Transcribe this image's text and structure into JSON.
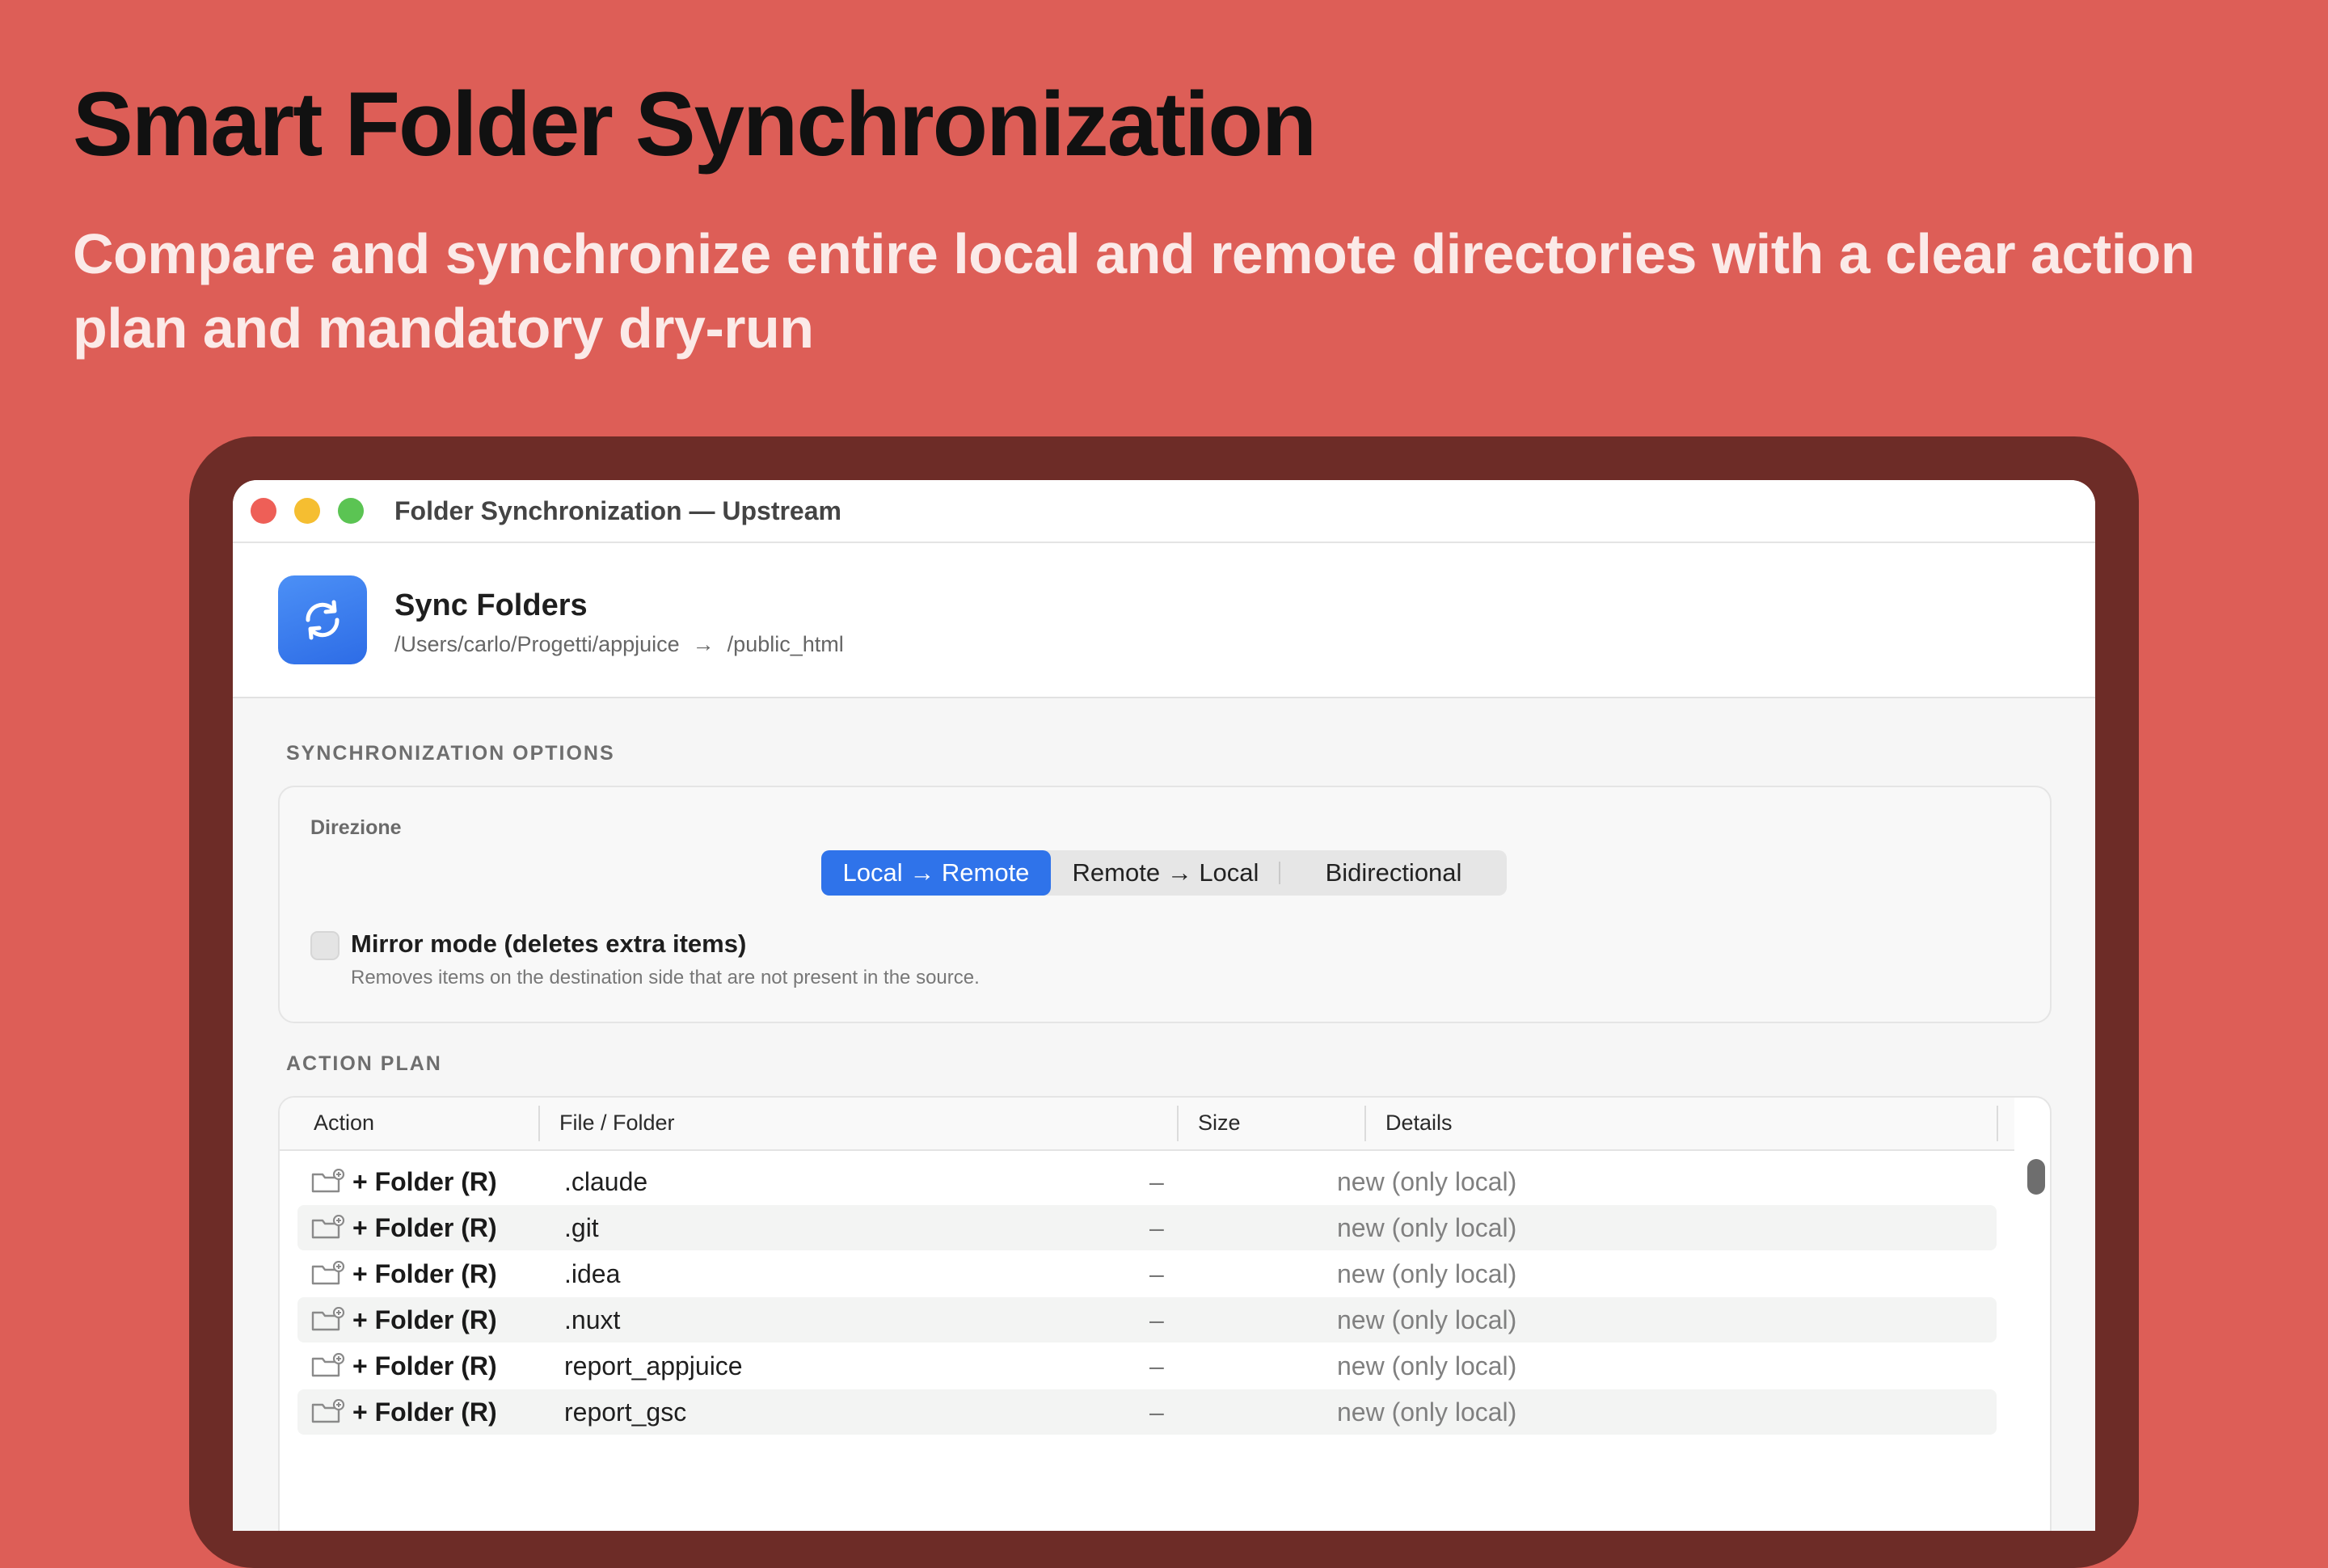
{
  "page": {
    "headline": "Smart Folder Synchronization",
    "subhead": "Compare and synchronize entire local and remote directories with a clear action plan and mandatory dry-run"
  },
  "window": {
    "title": "Folder Synchronization — Upstream"
  },
  "sync_header": {
    "title": "Sync Folders",
    "local_path": "/Users/carlo/Progetti/appjuice",
    "arrow": "→",
    "remote_path": "/public_html",
    "icon": "sync-arrows-icon"
  },
  "options": {
    "section_label": "SYNCHRONIZATION OPTIONS",
    "direction_label": "Direzione",
    "directions": [
      "Local → Remote",
      "Remote → Local",
      "Bidirectional"
    ],
    "selected_direction": "Local → Remote",
    "mirror_label": "Mirror mode (deletes extra items)",
    "mirror_help": "Removes items on the destination side that are not present in the source.",
    "mirror_checked": false
  },
  "action_plan": {
    "section_label": "ACTION PLAN",
    "columns": [
      "Action",
      "File / Folder",
      "Size",
      "Details"
    ],
    "rows": [
      {
        "action": "+ Folder (R)",
        "file": ".claude",
        "size": "–",
        "details": "new (only local)"
      },
      {
        "action": "+ Folder (R)",
        "file": ".git",
        "size": "–",
        "details": "new (only local)"
      },
      {
        "action": "+ Folder (R)",
        "file": ".idea",
        "size": "–",
        "details": "new (only local)"
      },
      {
        "action": "+ Folder (R)",
        "file": ".nuxt",
        "size": "–",
        "details": "new (only local)"
      },
      {
        "action": "+ Folder (R)",
        "file": "report_appjuice",
        "size": "–",
        "details": "new (only local)"
      },
      {
        "action": "+ Folder (R)",
        "file": "report_gsc",
        "size": "–",
        "details": "new (only local)"
      }
    ]
  },
  "colors": {
    "background": "#DD5E57",
    "device_frame": "#6D2C27",
    "accent": "#2F73EA"
  }
}
